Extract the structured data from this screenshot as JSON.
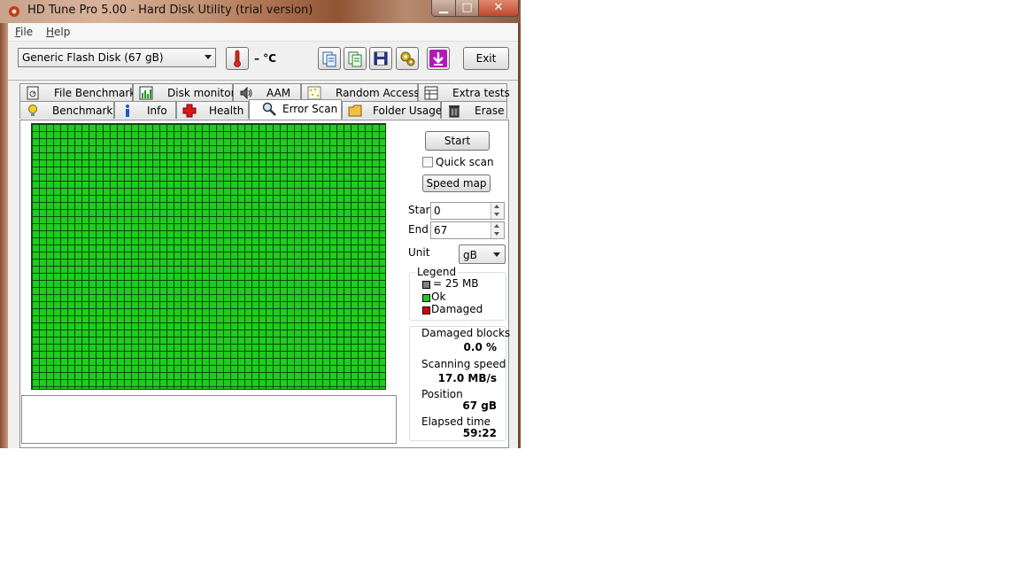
{
  "window": {
    "title": "HD Tune Pro 5.00 - Hard Disk Utility (trial version)",
    "caption_buttons": {
      "minimize": "▁",
      "maximize": "□",
      "close": "✕"
    }
  },
  "menu": [
    "File",
    "Help"
  ],
  "toolbar": {
    "drive": "Generic Flash Disk      (67 gB)",
    "temperature": "– °C",
    "exit_label": "Exit"
  },
  "tabs_row1": [
    {
      "label": "File Benchmark",
      "icon": "file-benchmark-icon"
    },
    {
      "label": "Disk monitor",
      "icon": "disk-monitor-icon"
    },
    {
      "label": "AAM",
      "icon": "speaker-icon"
    },
    {
      "label": "Random Access",
      "icon": "random-access-icon"
    },
    {
      "label": "Extra tests",
      "icon": "extra-tests-icon"
    }
  ],
  "tabs_row2": [
    {
      "label": "Benchmark",
      "icon": "lightbulb-icon"
    },
    {
      "label": "Info",
      "icon": "info-icon"
    },
    {
      "label": "Health",
      "icon": "health-cross-icon"
    },
    {
      "label": "Error Scan",
      "icon": "magnifier-icon",
      "active": true
    },
    {
      "label": "Folder Usage",
      "icon": "folder-icon"
    },
    {
      "label": "Erase",
      "icon": "trash-icon"
    }
  ],
  "error_scan": {
    "start_button": "Start",
    "quick_scan_label": "Quick scan",
    "quick_scan_checked": false,
    "speed_map_button": "Speed map",
    "start_label": "Start",
    "start_value": "0",
    "end_label": "End",
    "end_value": "67",
    "unit_label": "Unit",
    "unit_value": "gB",
    "block_status": "all ok"
  },
  "legend": {
    "title": "Legend",
    "block_size": "= 25 MB",
    "ok": "Ok",
    "damaged": "Damaged",
    "colors": {
      "block": "#808080",
      "ok": "#1fcc1f",
      "damaged": "#dd0000"
    }
  },
  "stats": {
    "damaged_blocks_label": "Damaged blocks",
    "damaged_blocks_value": "0.0 %",
    "scanning_speed_label": "Scanning speed",
    "scanning_speed_value": "17.0 MB/s",
    "position_label": "Position",
    "position_value": "67 gB",
    "elapsed_label": "Elapsed time",
    "elapsed_value": "59:22"
  }
}
